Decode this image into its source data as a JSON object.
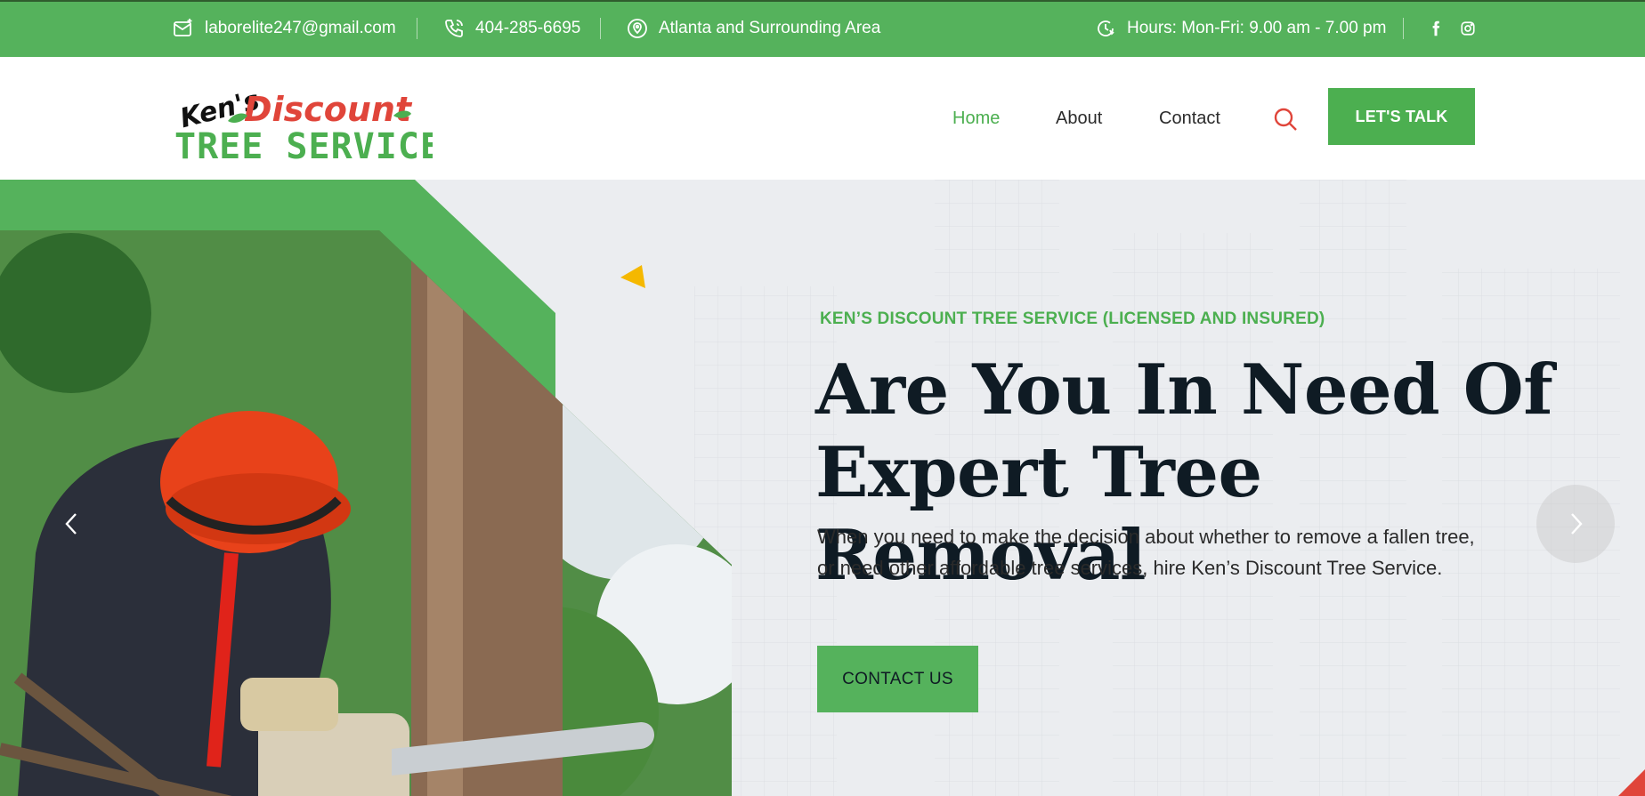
{
  "topbar": {
    "email": "laborelite247@gmail.com",
    "phone": "404-285-6695",
    "area": "Atlanta and Surrounding Area",
    "hours": "Hours: Mon-Fri: 9.00 am - 7.00 pm",
    "icons": [
      "email-icon",
      "phone-icon",
      "location-icon",
      "clock-icon",
      "facebook-icon",
      "instagram-icon"
    ]
  },
  "header": {
    "logo": {
      "line1": "Ken's",
      "line2": "Discount",
      "line3": "TREE SERVICE"
    },
    "nav": [
      {
        "label": "Home",
        "active": true
      },
      {
        "label": "About",
        "active": false
      },
      {
        "label": "Contact",
        "active": false
      }
    ],
    "cta": "LET'S TALK"
  },
  "hero": {
    "subtitle": "KEN’S DISCOUNT TREE SERVICE (LICENSED AND INSURED)",
    "headline_line1": "Are You In Need Of",
    "headline_line2": "Expert Tree Removal",
    "description": "When you need to make the decision about whether to remove a fallen tree, or need other affordable tree services, hire Ken’s Discount Tree Service.",
    "button": "CONTACT US"
  },
  "colors": {
    "brand_green": "#55b25c",
    "accent_red": "#e0453a",
    "accent_yellow": "#f5b800",
    "headline": "#0f1b24"
  }
}
